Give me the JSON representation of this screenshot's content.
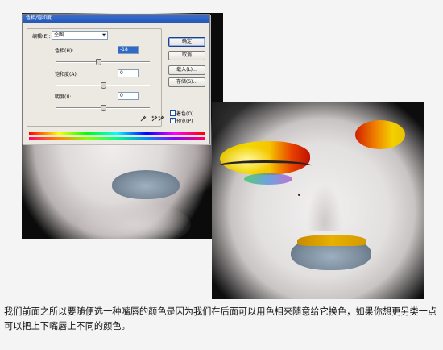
{
  "dialog": {
    "title": "色相/饱和度",
    "edit_label": "编辑(E):",
    "edit_value": "全图",
    "hue_label": "色相(H):",
    "hue_value": "-18",
    "hue_level": 0.45,
    "saturation_label": "饱和度(A):",
    "saturation_value": "0",
    "saturation_level": 0.5,
    "lightness_label": "明度(I):",
    "lightness_value": "0",
    "lightness_level": 0.5,
    "buttons": {
      "ok": "确定",
      "cancel": "取消",
      "load": "载入(L)...",
      "save": "存储(S)..."
    },
    "colorize_label": "着色(O)",
    "colorize_checked": false,
    "preview_label": "预览(P)",
    "preview_checked": true,
    "icons": [
      "eyedropper-icon",
      "eyedropper-plus-icon",
      "eyedropper-minus-icon"
    ]
  },
  "caption": "我们前面之所以要随便选一种嘴唇的颜色是因为我们在后面可以用色相来随意给它换色，如果你想更另类一点可以把上下嘴唇上不同的颜色。"
}
